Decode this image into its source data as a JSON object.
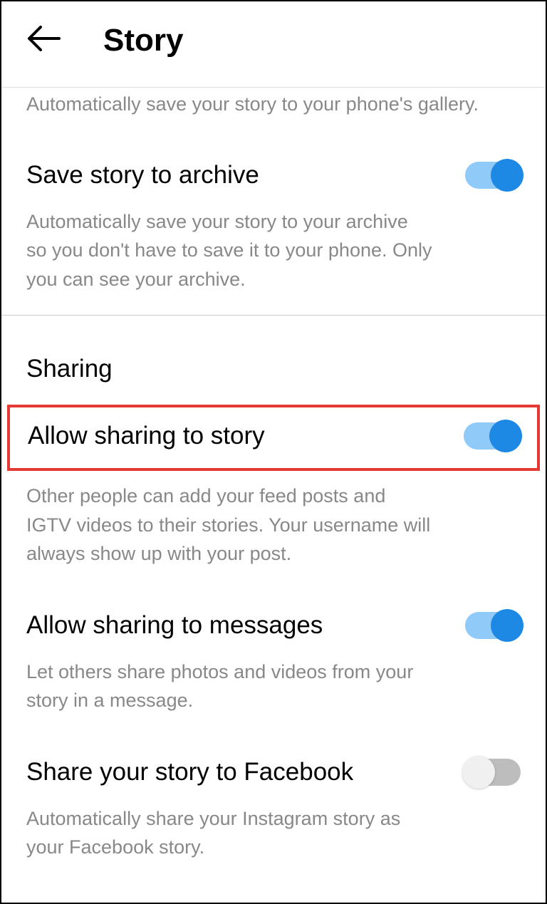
{
  "header": {
    "title": "Story"
  },
  "settings": {
    "saveGallery": {
      "description": "Automatically save your story to your phone's gallery."
    },
    "saveArchive": {
      "label": "Save story to archive",
      "description": "Automatically save your story to your archive so you don't have to save it to your phone. Only you can see your archive.",
      "enabled": true
    },
    "sharingSection": {
      "title": "Sharing"
    },
    "allowSharingStory": {
      "label": "Allow sharing to story",
      "description": "Other people can add your feed posts and IGTV videos to their stories. Your username will always show up with your post.",
      "enabled": true
    },
    "allowSharingMessages": {
      "label": "Allow sharing to messages",
      "description": "Let others share photos and videos from your story in a message.",
      "enabled": true
    },
    "shareFacebook": {
      "label": "Share your story to Facebook",
      "description": "Automatically share your Instagram story as your Facebook story.",
      "enabled": false
    }
  }
}
